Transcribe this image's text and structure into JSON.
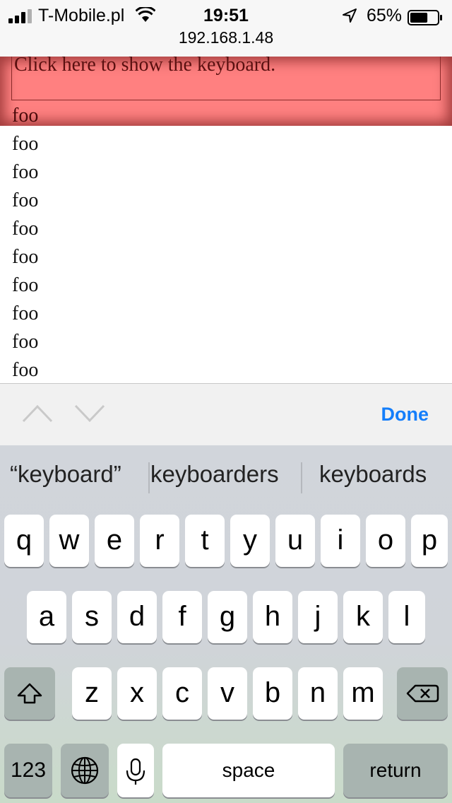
{
  "status": {
    "carrier": "T-Mobile.pl",
    "time": "19:51",
    "battery": "65%",
    "battery_level": 0.65
  },
  "browser": {
    "url": "192.168.1.48"
  },
  "page": {
    "input_text": "Click here to show the keyboard.",
    "lines": [
      "foo",
      "foo",
      "foo",
      "foo",
      "foo",
      "foo",
      "foo",
      "foo",
      "foo",
      "foo"
    ]
  },
  "accessory": {
    "done_label": "Done"
  },
  "keyboard": {
    "suggestions": [
      "“keyboard”",
      "keyboarders",
      "keyboards"
    ],
    "row1": [
      "q",
      "w",
      "e",
      "r",
      "t",
      "y",
      "u",
      "i",
      "o",
      "p"
    ],
    "row2": [
      "a",
      "s",
      "d",
      "f",
      "g",
      "h",
      "j",
      "k",
      "l"
    ],
    "row3": [
      "z",
      "x",
      "c",
      "v",
      "b",
      "n",
      "m"
    ],
    "numbers_label": "123",
    "space_label": "space",
    "return_label": "return"
  },
  "colors": {
    "accent": "#147efb",
    "highlight": "#ff8080"
  }
}
